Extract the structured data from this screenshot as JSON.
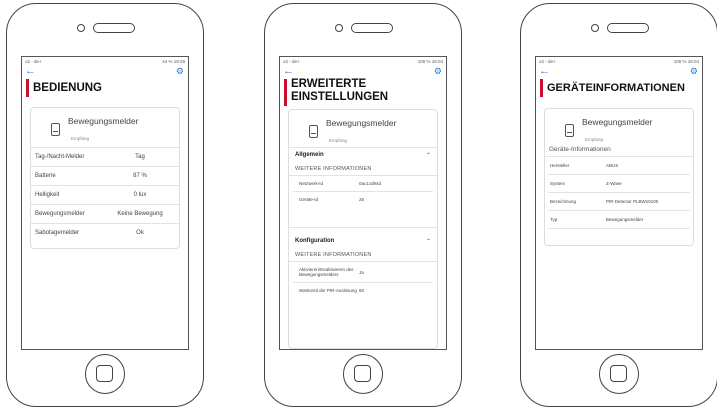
{
  "phone1": {
    "status_left": "o2 - de+",
    "status_right": "44 % 19:29",
    "title": "BEDIENUNG",
    "device_name": "Bewegungsmelder",
    "device_sub": "Empfang",
    "rows": [
      {
        "label": "Tag-/Nacht-Melder",
        "value": "Tag"
      },
      {
        "label": "Batterie",
        "value": "87 %"
      },
      {
        "label": "Helligkeit",
        "value": "0 lux"
      },
      {
        "label": "Bewegungsmelder",
        "value": "Keine Bewegung"
      },
      {
        "label": "Sabotagemelder",
        "value": "Ok"
      }
    ]
  },
  "phone2": {
    "status_left": "o2 - de+",
    "status_right": "100 % 16:04",
    "title_line1": "ERWEITERTE",
    "title_line2": "EINSTELLUNGEN",
    "device_name": "Bewegungsmelder",
    "device_sub": "Empfang",
    "section1": {
      "title": "Allgemein",
      "sublabel": "WEITERE INFORMATIONEN",
      "rows": [
        {
          "label": "Netzwerk-Id",
          "value": "0ac1cd94d"
        },
        {
          "label": "Geräte-Id",
          "value": "25"
        }
      ]
    },
    "section2": {
      "title": "Konfiguration",
      "sublabel": "WEITERE INFORMATIONEN",
      "rows": [
        {
          "label": "Aktivieren/Deaktivieren des Bewegungsmelders",
          "value": "Ja"
        },
        {
          "label": "Wartezeit der PIR-Auslösung",
          "value": "60"
        }
      ]
    }
  },
  "phone3": {
    "status_left": "o2 - de+",
    "status_right": "100 % 16:04",
    "title": "GERÄTEINFORMATIONEN",
    "device_name": "Bewegungsmelder",
    "device_sub": "Empfang",
    "section_label": "Geräte-Informationen",
    "rows": [
      {
        "label": "Hersteller",
        "value": "ABUS"
      },
      {
        "label": "System",
        "value": "Z-Wave"
      },
      {
        "label": "Bezeichnung",
        "value": "PIR Detector PLBW10100"
      },
      {
        "label": "Typ",
        "value": "Bewegungsmelder"
      }
    ]
  },
  "icons": {
    "back": "arrow-left",
    "settings": "gear",
    "device": "motion-detector",
    "collapse": "chevron-up"
  },
  "colors": {
    "accent_bar": "#c8102e",
    "link_blue": "#2a7fd4"
  }
}
